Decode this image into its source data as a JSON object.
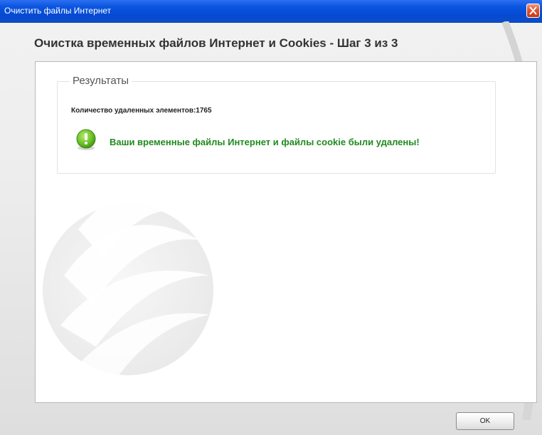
{
  "window": {
    "title": "Очистить файлы Интернет"
  },
  "header": {
    "title": "Очистка временных файлов Интернет и Cookies - Шаг 3 из 3"
  },
  "results": {
    "legend": "Результаты",
    "deleted_count_text": "Количество удаленных элементов:1765",
    "success_message": "Ваши временные файлы Интернет и файлы cookie были удалены!"
  },
  "footer": {
    "ok_label": "OK"
  },
  "colors": {
    "titlebar": "#0a56e0",
    "success_text": "#1f8a1f",
    "success_icon": "#6cc12a",
    "close_button": "#e0532e"
  },
  "icons": {
    "close": "close-icon",
    "success": "success-exclamation-icon",
    "watermark": "brand-sphere-watermark"
  }
}
